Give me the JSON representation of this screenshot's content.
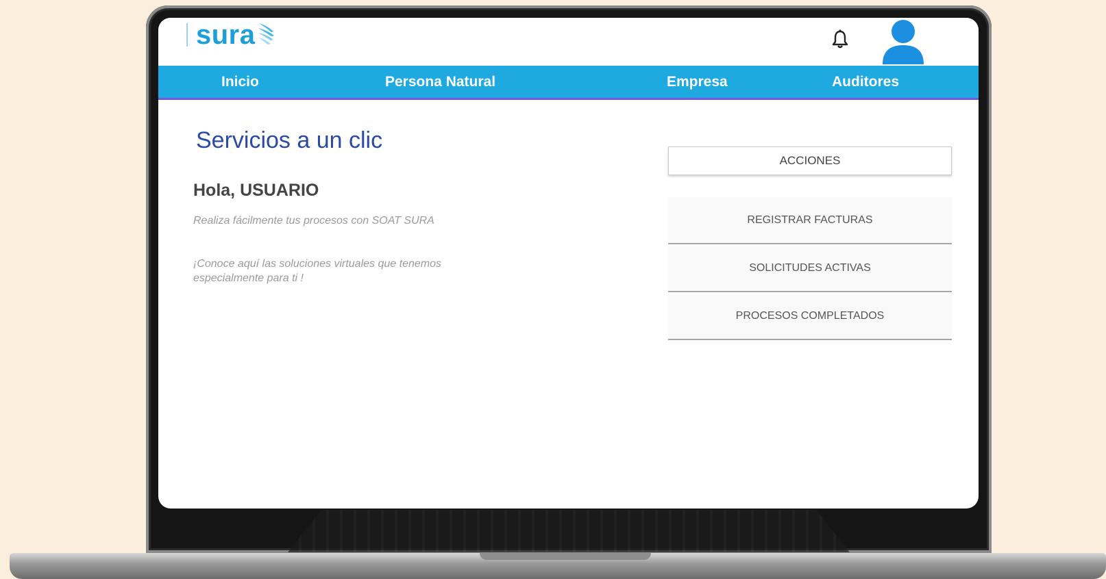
{
  "header": {
    "logo_text": "sura",
    "bell_icon": "bell-icon",
    "avatar_icon": "user-avatar-icon"
  },
  "nav": {
    "items": [
      {
        "label": "Inicio"
      },
      {
        "label": "Persona Natural"
      },
      {
        "label": "Empresa"
      },
      {
        "label": "Auditores"
      }
    ]
  },
  "main": {
    "title": "Servicios a un clic",
    "greeting": "Hola, USUARIO",
    "description_1": "Realiza fácilmente tus procesos con SOAT SURA",
    "description_2": "¡Conoce aquí las soluciones virtuales que tenemos especialmente para ti !"
  },
  "actions": {
    "header": "ACCIONES",
    "items": [
      {
        "label": "REGISTRAR FACTURAS"
      },
      {
        "label": "SOLICITUDES ACTIVAS"
      },
      {
        "label": "PROCESOS COMPLETADOS"
      }
    ]
  },
  "colors": {
    "background": "#fbeedd",
    "nav_bg": "#1ea9e1",
    "nav_accent": "#7a56d8",
    "brand_blue": "#1e9fd8",
    "title_blue": "#2a4aa4"
  }
}
